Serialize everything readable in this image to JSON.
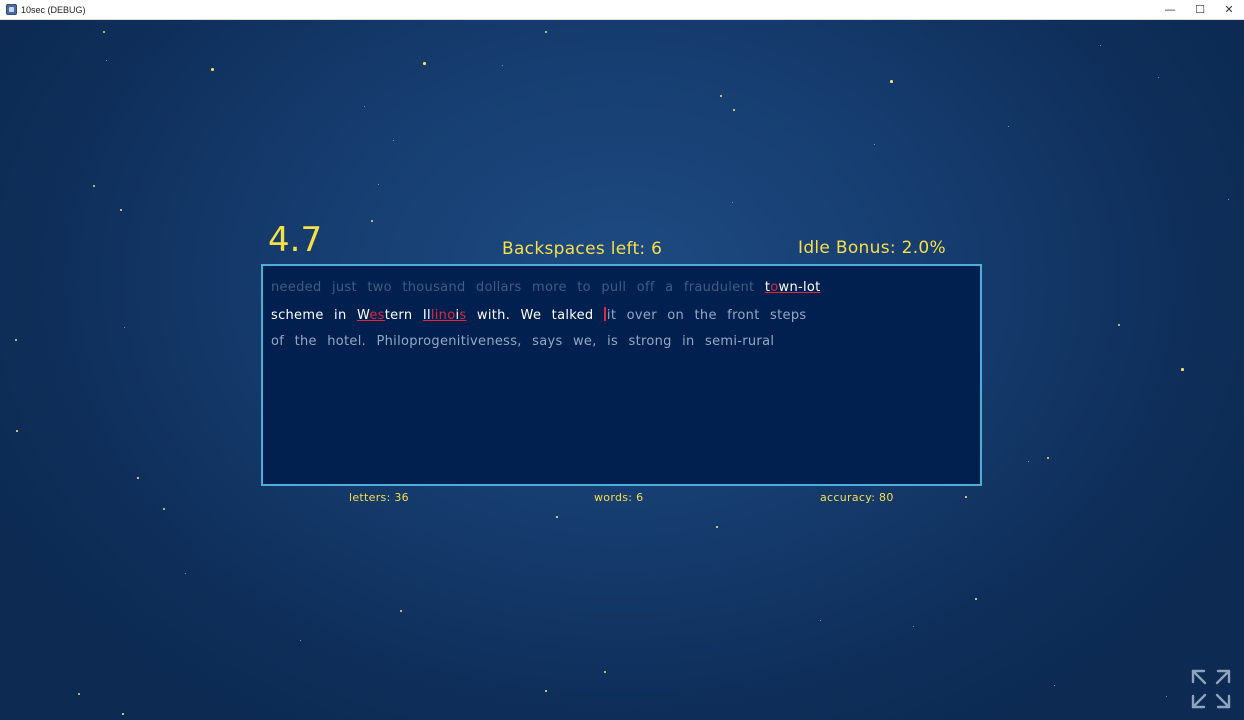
{
  "window": {
    "title": "10sec (DEBUG)",
    "minimize_glyph": "—",
    "maximize_glyph": "☐",
    "close_glyph": "✕"
  },
  "hud": {
    "timer": "4.7",
    "backspaces_left": "Backspaces left: 6",
    "idle_bonus": "Idle Bonus: 2.0%"
  },
  "text": {
    "line1": {
      "typed_old": "needed just two thousand dollars more to pull off a fraudulent ",
      "w_t": "t",
      "w_o": "o",
      "w_rest": "wn-lot"
    },
    "line2": {
      "scheme_in": "scheme in ",
      "w_W": "W",
      "w_es": "es",
      "w_tern": "tern ",
      "w_Il": "Il",
      "w_lino": "lino",
      "w_i": "i",
      "w_s": "s",
      "after_illinois": " with. We talked ",
      "cursor_char": "i",
      "pending": "t over on the front steps"
    },
    "line3": {
      "pending": "of the hotel. Philoprogenitiveness, says we, is strong in semi-rural"
    }
  },
  "stats": {
    "letters": "letters: 36",
    "words": "words: 6",
    "accuracy": "accuracy: 80"
  },
  "colors": {
    "accent_yellow": "#f7df4a",
    "panel_border": "#4ab0d8",
    "panel_bg": "#02204f",
    "error_red": "#e0283c"
  },
  "icons": {
    "fullscreen": "expand-arrows-icon",
    "app": "app-icon"
  }
}
